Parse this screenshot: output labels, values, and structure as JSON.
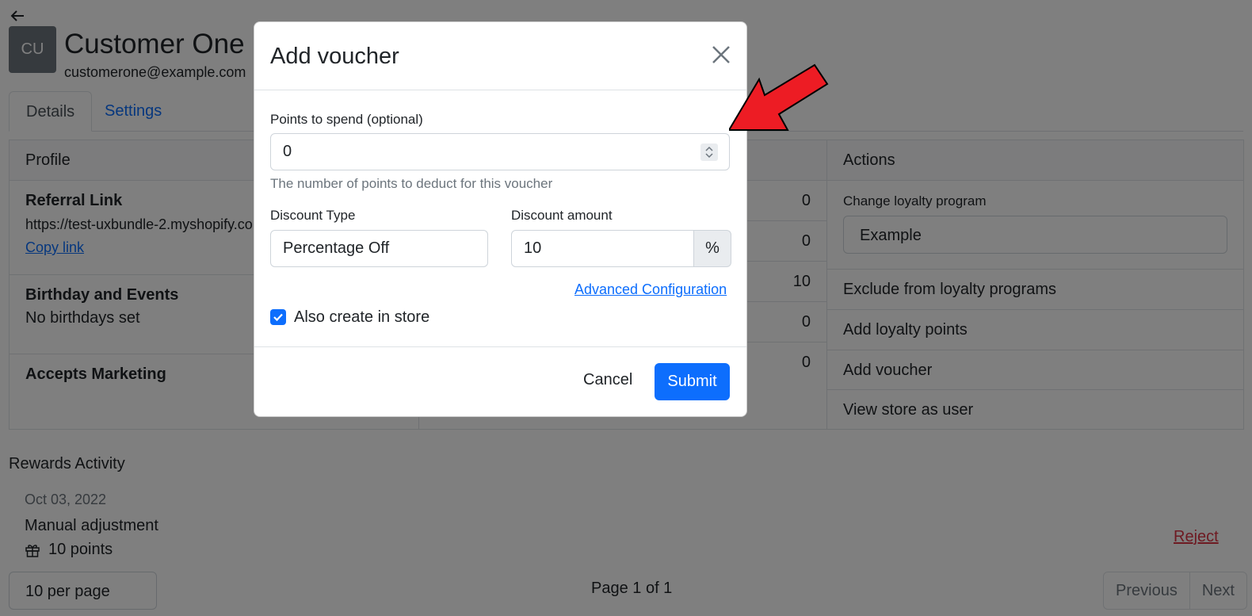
{
  "customer": {
    "initials": "CU",
    "name": "Customer One",
    "email": "customerone@example.com"
  },
  "tabs": [
    "Details",
    "Settings"
  ],
  "profile": {
    "header": "Profile",
    "referral_title": "Referral Link",
    "referral_url": "https://test-uxbundle-2.myshopify.co",
    "copy_link": "Copy link",
    "birthday_title": "Birthday and Events",
    "birthday_text": "No birthdays set",
    "marketing_title": "Accepts Marketing"
  },
  "stats": {
    "values": [
      "0",
      "0",
      "10",
      "0",
      "0"
    ]
  },
  "actions": {
    "header": "Actions",
    "change_label": "Change loyalty program",
    "program_value": "Example",
    "items": [
      "Exclude from loyalty programs",
      "Add loyalty points",
      "Add voucher",
      "View store as user"
    ]
  },
  "rewards": {
    "title": "Rewards Activity",
    "date": "Oct 03, 2022",
    "name": "Manual adjustment",
    "points": "10 points",
    "reject": "Reject"
  },
  "pagination": {
    "per_page": "10 per page",
    "page_info": "Page 1 of 1",
    "previous": "Previous",
    "next": "Next"
  },
  "modal": {
    "title": "Add voucher",
    "points_label": "Points to spend (optional)",
    "points_value": "0",
    "points_help": "The number of points to deduct for this voucher",
    "discount_type_label": "Discount Type",
    "discount_type_value": "Percentage Off",
    "discount_amount_label": "Discount amount",
    "discount_amount_value": "10",
    "discount_suffix": "%",
    "advanced_link": "Advanced Configuration",
    "also_create_label": "Also create in store",
    "also_create_checked": true,
    "cancel": "Cancel",
    "submit": "Submit"
  },
  "colors": {
    "primary": "#0d6efd",
    "danger": "#dc3545",
    "arrow": "#ed1c24",
    "backdrop": "rgba(0,0,0,0.5)"
  }
}
